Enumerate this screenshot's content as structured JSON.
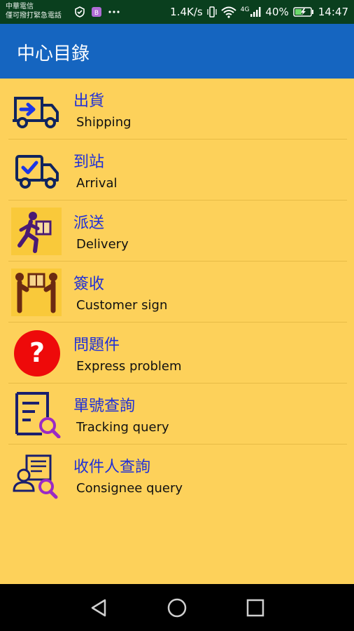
{
  "status_bar": {
    "carrier_line1": "中華電信",
    "carrier_line2": "僅可撥打緊急電話",
    "network_speed": "1.4K/s",
    "network_type": "4G",
    "battery": "40%",
    "time": "14:47"
  },
  "app_bar": {
    "title": "中心目錄"
  },
  "menu": {
    "items": [
      {
        "label_zh": "出貨",
        "label_en": "Shipping",
        "icon": "shipping-truck-icon"
      },
      {
        "label_zh": "到站",
        "label_en": "Arrival",
        "icon": "arrival-truck-icon"
      },
      {
        "label_zh": "派送",
        "label_en": "Delivery",
        "icon": "delivery-person-icon"
      },
      {
        "label_zh": "簽收",
        "label_en": "Customer sign",
        "icon": "handover-icon"
      },
      {
        "label_zh": "問題件",
        "label_en": "Express problem",
        "icon": "question-icon"
      },
      {
        "label_zh": "單號查詢",
        "label_en": "Tracking query",
        "icon": "document-search-icon"
      },
      {
        "label_zh": "收件人查詢",
        "label_en": "Consignee query",
        "icon": "person-search-icon"
      }
    ]
  },
  "colors": {
    "status_bar": "#0a3f1e",
    "app_bar": "#1565c0",
    "background": "#fdd15a",
    "label_zh": "#1f2fd8",
    "question_red": "#ee0a0a"
  }
}
